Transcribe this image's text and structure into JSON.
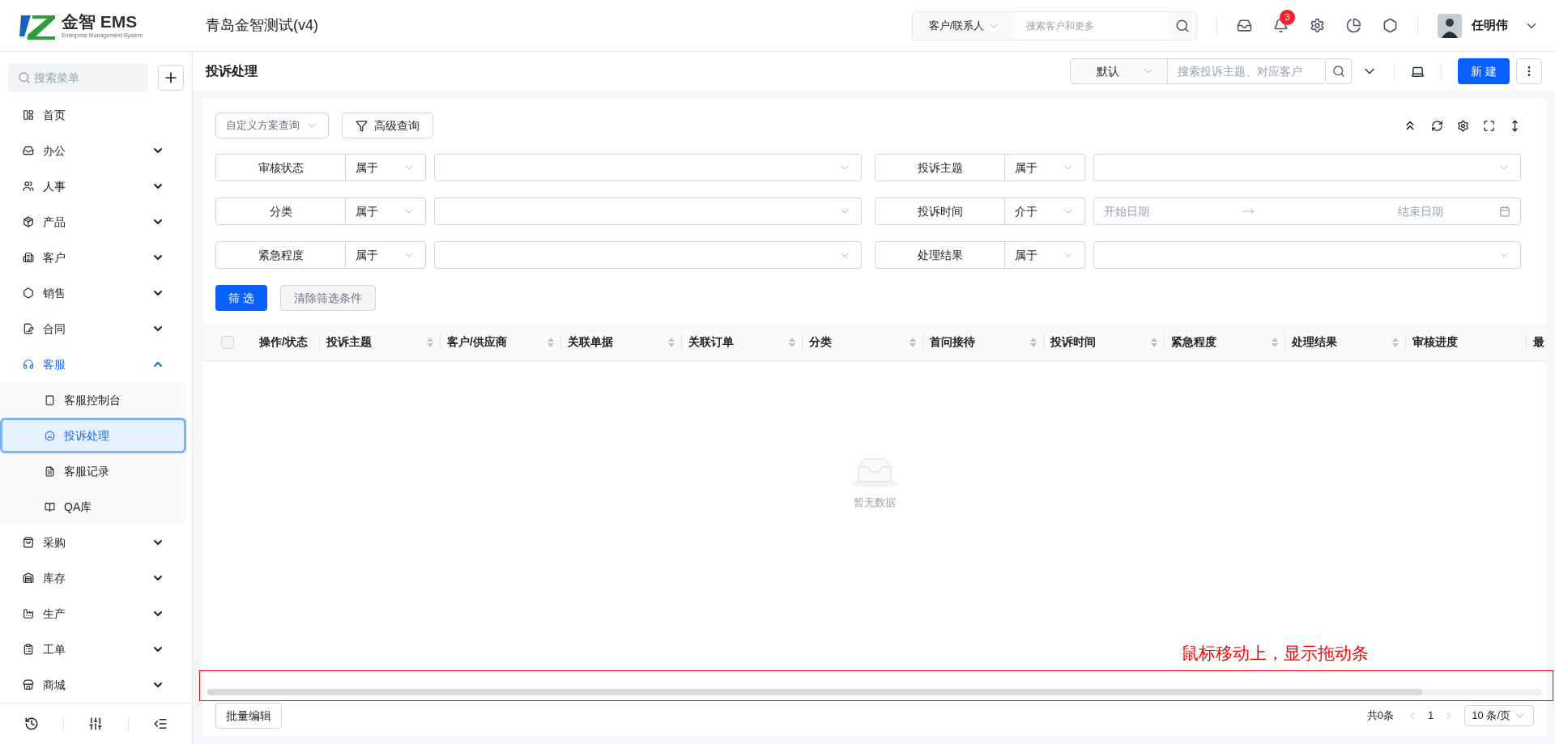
{
  "app": {
    "brand": "金智 EMS",
    "brand_subtitle": "Enterprise Management System",
    "company": "青岛金智测试(v4)"
  },
  "top_search": {
    "scope": "客户/联系人",
    "placeholder": "搜索客户和更多"
  },
  "notifications": {
    "badge": "3"
  },
  "user": {
    "name": "任明伟"
  },
  "sidebar": {
    "search_placeholder": "搜索菜单",
    "items": [
      {
        "label": "首页",
        "selected": false
      },
      {
        "label": "办公",
        "selected": false,
        "expanded": false
      },
      {
        "label": "人事",
        "selected": false,
        "expanded": false
      },
      {
        "label": "产品",
        "selected": false,
        "expanded": false
      },
      {
        "label": "客户",
        "selected": false,
        "expanded": false
      },
      {
        "label": "销售",
        "selected": false,
        "expanded": false
      },
      {
        "label": "合同",
        "selected": false,
        "expanded": false
      },
      {
        "label": "客服",
        "selected": true,
        "expanded": true,
        "children": [
          {
            "label": "客服控制台",
            "selected": false
          },
          {
            "label": "投诉处理",
            "selected": true
          },
          {
            "label": "客服记录",
            "selected": false
          },
          {
            "label": "QA库",
            "selected": false
          }
        ]
      },
      {
        "label": "采购",
        "selected": false,
        "expanded": false
      },
      {
        "label": "库存",
        "selected": false,
        "expanded": false
      },
      {
        "label": "生产",
        "selected": false,
        "expanded": false
      },
      {
        "label": "工单",
        "selected": false,
        "expanded": false
      },
      {
        "label": "商城",
        "selected": false,
        "expanded": false
      }
    ]
  },
  "page": {
    "title": "投诉处理",
    "view": "默认",
    "search_placeholder": "搜索投诉主题、对应客户",
    "new_button": "新 建"
  },
  "filters": {
    "scheme_placeholder": "自定义方案查询",
    "advanced": "高级查询",
    "conditions": [
      {
        "field": "审核状态",
        "operator": "属于",
        "kind": "select"
      },
      {
        "field": "投诉主题",
        "operator": "属于",
        "kind": "select"
      },
      {
        "field": "分类",
        "operator": "属于",
        "kind": "select"
      },
      {
        "field": "投诉时间",
        "operator": "介于",
        "kind": "daterange",
        "start_placeholder": "开始日期",
        "end_placeholder": "结束日期"
      },
      {
        "field": "紧急程度",
        "operator": "属于",
        "kind": "select"
      },
      {
        "field": "处理结果",
        "operator": "属于",
        "kind": "select"
      }
    ],
    "buttons": [
      {
        "label": "筛 选",
        "kind": "primary",
        "disabled": false
      },
      {
        "label": "清除筛选条件",
        "kind": "default",
        "disabled": true
      }
    ]
  },
  "table": {
    "select_all_checked": false,
    "columns": [
      {
        "label": "操作/状态",
        "sortable": false
      },
      {
        "label": "投诉主题",
        "sortable": true
      },
      {
        "label": "客户/供应商",
        "sortable": true
      },
      {
        "label": "关联单据",
        "sortable": true
      },
      {
        "label": "关联订单",
        "sortable": true
      },
      {
        "label": "分类",
        "sortable": true
      },
      {
        "label": "首问接待",
        "sortable": true
      },
      {
        "label": "投诉时间",
        "sortable": true
      },
      {
        "label": "紧急程度",
        "sortable": true
      },
      {
        "label": "处理结果",
        "sortable": true
      },
      {
        "label": "审核进度",
        "sortable": false
      },
      {
        "label": "最"
      }
    ],
    "empty_text": "暂无数据"
  },
  "annotation": {
    "text": "鼠标移动上，显示拖动条"
  },
  "footer": {
    "batch_edit": "批量编辑",
    "total": "共0条",
    "page": "1",
    "page_size": "10 条/页"
  }
}
